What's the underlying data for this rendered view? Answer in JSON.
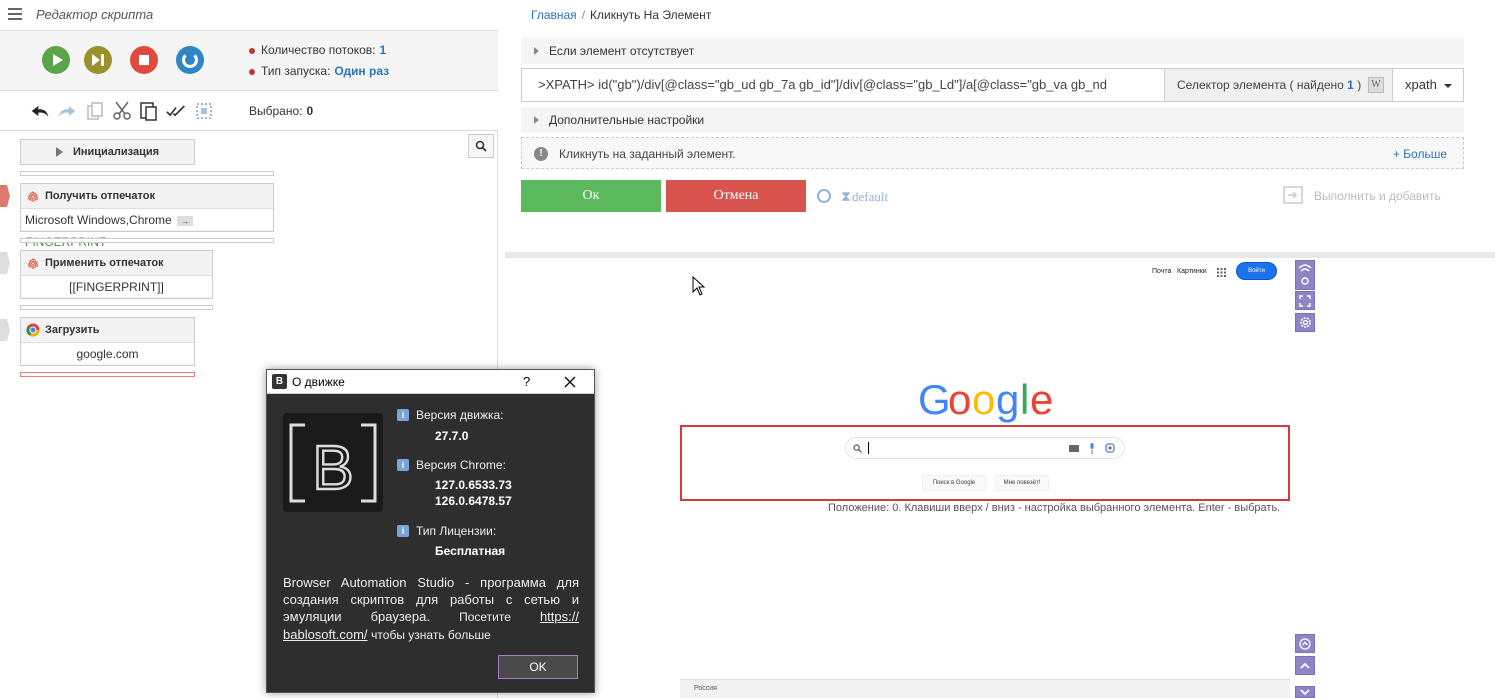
{
  "editor": {
    "title": "Редактор скрипта",
    "threads_label": "Количество потоков:",
    "threads_value": "1",
    "launch_label": "Тип запуска:",
    "launch_value": "Один раз",
    "selected_label": "Выбрано:",
    "selected_value": "0"
  },
  "actions": [
    {
      "title": "Инициализация"
    },
    {
      "title": "Получить отпечаток",
      "body_left": "Microsoft Windows,Chrome",
      "body_right": "FINGERPRINT"
    },
    {
      "title": "Применить отпечаток",
      "body": "[[FINGERPRINT]]"
    },
    {
      "title": "Загрузить",
      "body": "google.com"
    }
  ],
  "panel": {
    "breadcrumb_home": "Главная",
    "breadcrumb_sep": "/",
    "breadcrumb_current": "Кликнуть На Элемент",
    "if_missing": "Если элемент отсутствует",
    "xpath_value": ">XPATH> id(\"gb\")/div[@class=\"gb_ud gb_7a gb_id\"]/div[@class=\"gb_Ld\"]/a[@class=\"gb_va gb_nd",
    "selector_label_prefix": "Селектор элемента ( найдено",
    "selector_found": "1",
    "selector_label_suffix": ")",
    "w_icon": "W",
    "selector_type": "xpath",
    "advanced": "Дополнительные настройки",
    "hint": "Кликнуть на заданный элемент.",
    "more": "+ Больше",
    "ok": "Ок",
    "cancel": "Отмена",
    "default_label": "default",
    "exec_add": "Выполнить и добавить"
  },
  "browser": {
    "link_mail": "Почта",
    "link_images": "Картинки",
    "signin": "Войти",
    "search_btn": "Поиск в Google",
    "lucky_btn": "Мне повезёт!",
    "position_text": "Положение: 0. Клавиши вверх / вниз - настройка выбранного элемента. Enter - выбрать.",
    "footer_country": "Россия"
  },
  "dialog": {
    "title": "О движке",
    "help": "?",
    "engine_label": "Версия движка:",
    "engine_value": "27.7.0",
    "chrome_label": "Версия Chrome:",
    "chrome_value_1": "127.0.6533.73",
    "chrome_value_2": "126.0.6478.57",
    "license_label": "Тип Лицензии:",
    "license_value": "Бесплатная",
    "desc_1": "Browser Automation Studio - программа для создания скриптов для работы с сетью и эмуляции браузера.",
    "desc_visit": "Посетите",
    "desc_link": "https:// bablosoft.com/",
    "desc_end": "чтобы узнать больше",
    "ok": "OK"
  },
  "colors": {
    "accent_blue": "#2a75b8",
    "ok_green": "#5cb85c",
    "cancel_red": "#d9534f",
    "highlight_red": "#d9383a"
  }
}
